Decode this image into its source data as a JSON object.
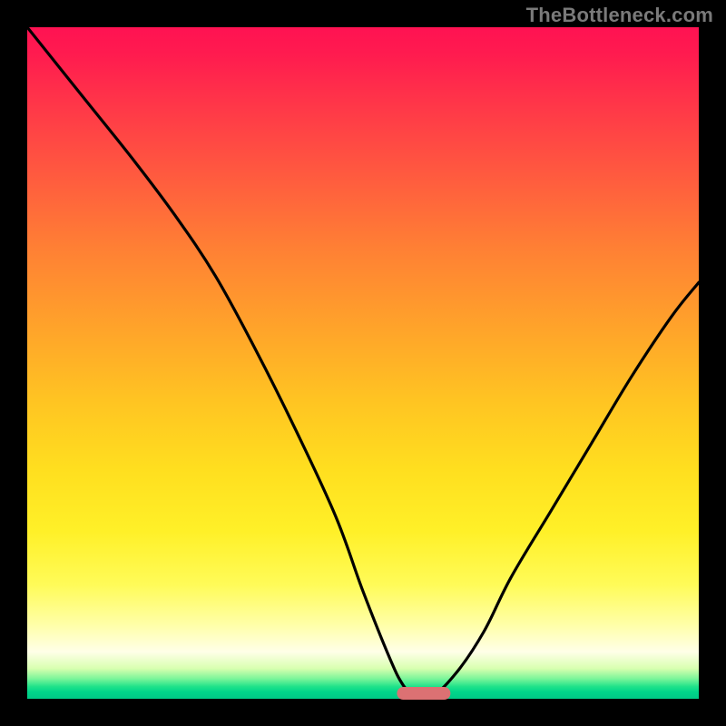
{
  "watermark": "TheBottleneck.com",
  "colors": {
    "frame": "#000000",
    "watermark_text": "#7a7a7a",
    "curve": "#000000",
    "marker": "#dc7173"
  },
  "chart_data": {
    "type": "line",
    "title": "",
    "xlabel": "",
    "ylabel": "",
    "xlim": [
      0,
      100
    ],
    "ylim": [
      0,
      100
    ],
    "grid": false,
    "legend": null,
    "annotations": [],
    "series": [
      {
        "name": "bottleneck-curve",
        "x": [
          0,
          8,
          16,
          22,
          28,
          34,
          40,
          46,
          50,
          54,
          56,
          58,
          60,
          64,
          68,
          72,
          78,
          84,
          90,
          96,
          100
        ],
        "values": [
          100,
          90,
          80,
          72,
          63,
          52,
          40,
          27,
          16,
          6,
          2,
          0,
          0,
          4,
          10,
          18,
          28,
          38,
          48,
          57,
          62
        ]
      }
    ],
    "minimum_marker": {
      "x_center": 59,
      "width_pct": 8
    }
  }
}
